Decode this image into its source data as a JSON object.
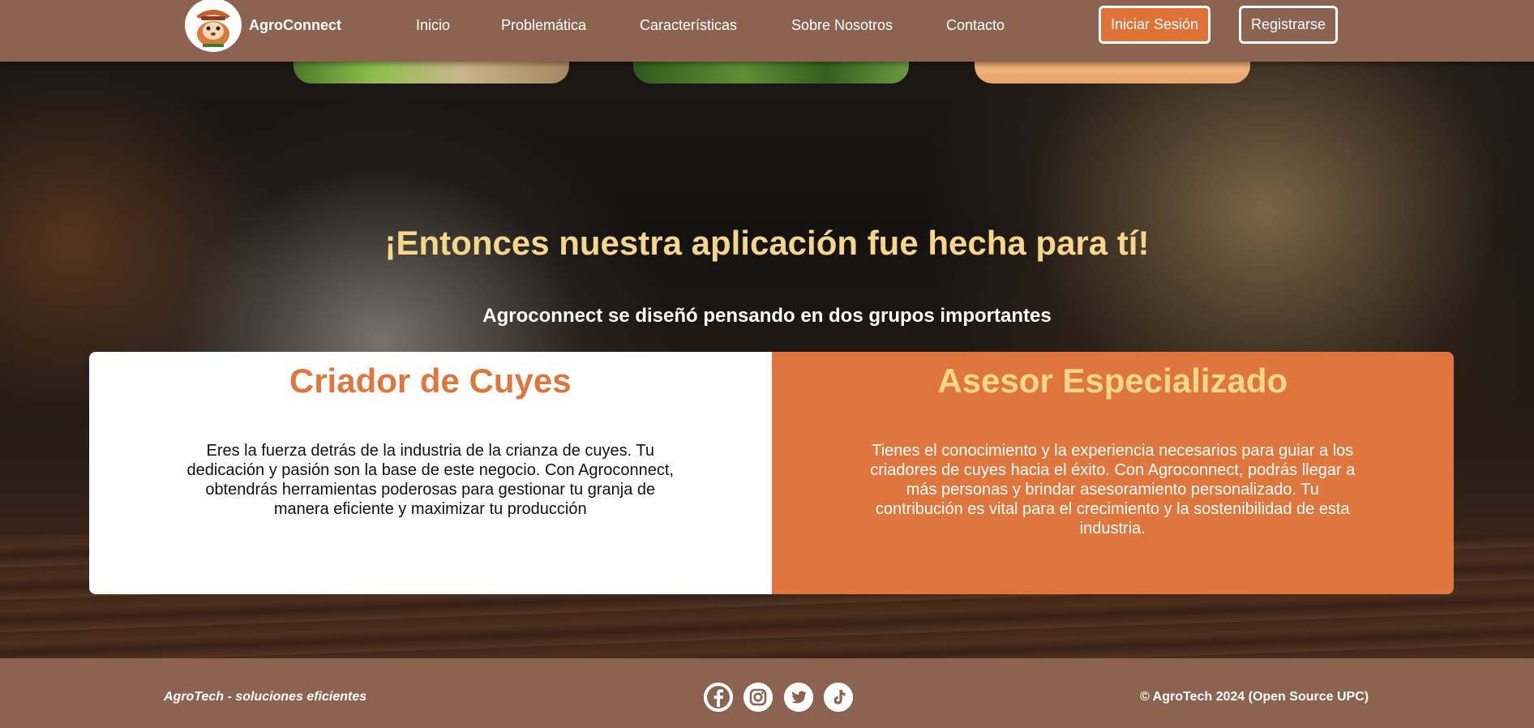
{
  "header": {
    "brand": "AgroConnect",
    "nav": [
      {
        "label": "Inicio"
      },
      {
        "label": "Problemática"
      },
      {
        "label": "Características"
      },
      {
        "label": "Sobre Nosotros"
      },
      {
        "label": "Contacto"
      }
    ],
    "login_label": "Iniciar Sesión",
    "register_label": "Registrarse"
  },
  "hero": {
    "headline": "¡Entonces nuestra aplicación fue hecha para tí!",
    "subheadline": "Agroconnect se diseñó pensando en dos grupos importantes"
  },
  "cards": [
    {
      "title": "Criador de Cuyes",
      "text": "Eres la fuerza detrás de la industria de la crianza de cuyes. Tu dedicación y pasión son la base de este negocio. Con Agroconnect, obtendrás herramientas poderosas para gestionar tu granja de manera eficiente y maximizar tu producción"
    },
    {
      "title": "Asesor Especializado",
      "text": "Tienes el conocimiento y la experiencia necesarios para guiar a los criadores de cuyes hacia el éxito. Con Agroconnect, podrás llegar a más personas y brindar asesoramiento personalizado. Tu contribución es vital para el crecimiento y la sostenibilidad de esta industria."
    }
  ],
  "footer": {
    "tagline": "AgroTech - soluciones eficientes",
    "copyright": "© AgroTech 2024 (Open Source UPC)",
    "social_icons": [
      "facebook-icon",
      "instagram-icon",
      "twitter-icon",
      "tiktok-icon"
    ]
  },
  "colors": {
    "header_bg": "#8c6250",
    "accent_orange": "#de763d",
    "headline_yellow": "#f5d68c",
    "white": "#ffffff"
  }
}
